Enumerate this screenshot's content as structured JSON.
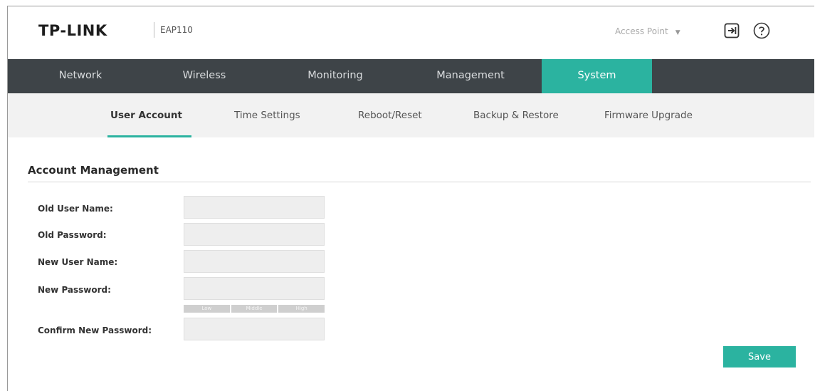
{
  "header": {
    "brand": "TP-LINK",
    "model": "EAP110",
    "mode": "Access Point",
    "logout_icon": "logout-icon",
    "help_icon": "help-icon"
  },
  "main_nav": {
    "tabs": [
      {
        "label": "Network",
        "active": false
      },
      {
        "label": "Wireless",
        "active": false
      },
      {
        "label": "Monitoring",
        "active": false
      },
      {
        "label": "Management",
        "active": false
      },
      {
        "label": "System",
        "active": true
      }
    ]
  },
  "sub_nav": {
    "tabs": [
      {
        "label": "User Account",
        "active": true
      },
      {
        "label": "Time Settings",
        "active": false
      },
      {
        "label": "Reboot/Reset",
        "active": false
      },
      {
        "label": "Backup & Restore",
        "active": false
      },
      {
        "label": "Firmware Upgrade",
        "active": false
      }
    ]
  },
  "account": {
    "title": "Account Management",
    "fields": [
      {
        "label": "Old User Name:",
        "value": ""
      },
      {
        "label": "Old Password:",
        "value": ""
      },
      {
        "label": "New User Name:",
        "value": ""
      },
      {
        "label": "New Password:",
        "value": ""
      },
      {
        "label": "Confirm New Password:",
        "value": ""
      }
    ],
    "strength_levels": [
      "Low",
      "Middle",
      "High"
    ],
    "save_label": "Save"
  },
  "colors": {
    "accent": "#2bb3a0",
    "nav_bg": "#3e4448",
    "subnav_bg": "#f2f2f2"
  }
}
